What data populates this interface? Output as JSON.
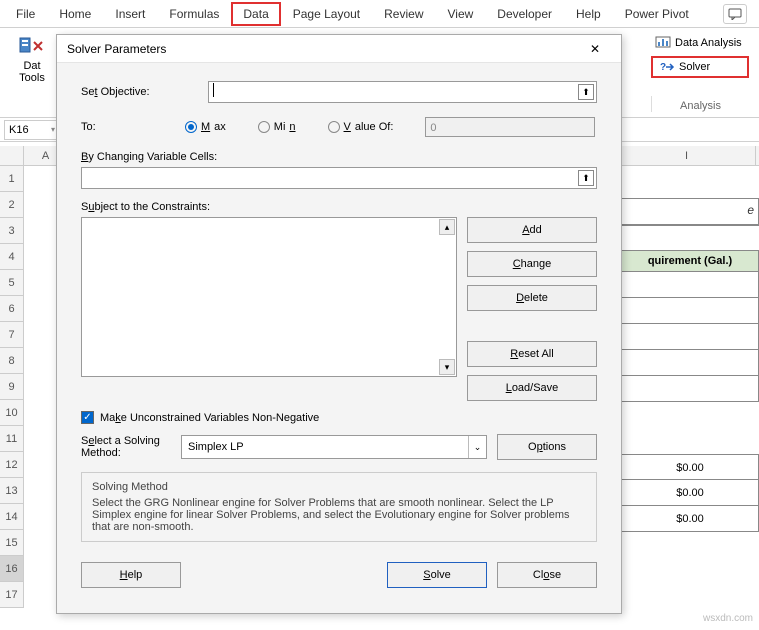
{
  "ribbon": {
    "tabs": [
      "File",
      "Home",
      "Insert",
      "Formulas",
      "Data",
      "Page Layout",
      "Review",
      "View",
      "Developer",
      "Help",
      "Power Pivot"
    ],
    "active": "Data",
    "group_left_line1": "Dat",
    "group_left_line2": "Tools",
    "data_analysis": "Data Analysis",
    "solver": "Solver",
    "analysis_group": "Analysis"
  },
  "namebox": "K16",
  "columns": {
    "A": "A",
    "I": "I"
  },
  "rows": [
    "1",
    "2",
    "3",
    "4",
    "5",
    "6",
    "7",
    "8",
    "9",
    "10",
    "11",
    "12",
    "13",
    "14",
    "15",
    "16",
    "17"
  ],
  "dialog": {
    "title": "Solver Parameters",
    "set_objective": "Set Objective:",
    "objective_value": "",
    "to": "To:",
    "max": "Max",
    "min": "Min",
    "value_of": "Value Of:",
    "value_of_value": "0",
    "by_changing": "By Changing Variable Cells:",
    "subject_to": "Subject to the Constraints:",
    "add": "Add",
    "change": "Change",
    "delete": "Delete",
    "reset_all": "Reset All",
    "load_save": "Load/Save",
    "make_unconstrained": "Make Unconstrained Variables Non-Negative",
    "select_method_lbl": "Select a Solving Method:",
    "selected_method": "Simplex LP",
    "options": "Options",
    "solving_method_hdr": "Solving Method",
    "solving_method_desc": "Select the GRG Nonlinear engine for Solver Problems that are smooth nonlinear. Select the LP Simplex engine for linear Solver Problems, and select the Evolutionary engine for Solver problems that are non-smooth.",
    "help": "Help",
    "solve": "Solve",
    "close": "Close"
  },
  "sheet": {
    "title_frag": "e",
    "header": "quirement (Gal.)",
    "vals": [
      "$0.00",
      "$0.00",
      "$0.00"
    ]
  },
  "watermark": "wsxdn.com"
}
